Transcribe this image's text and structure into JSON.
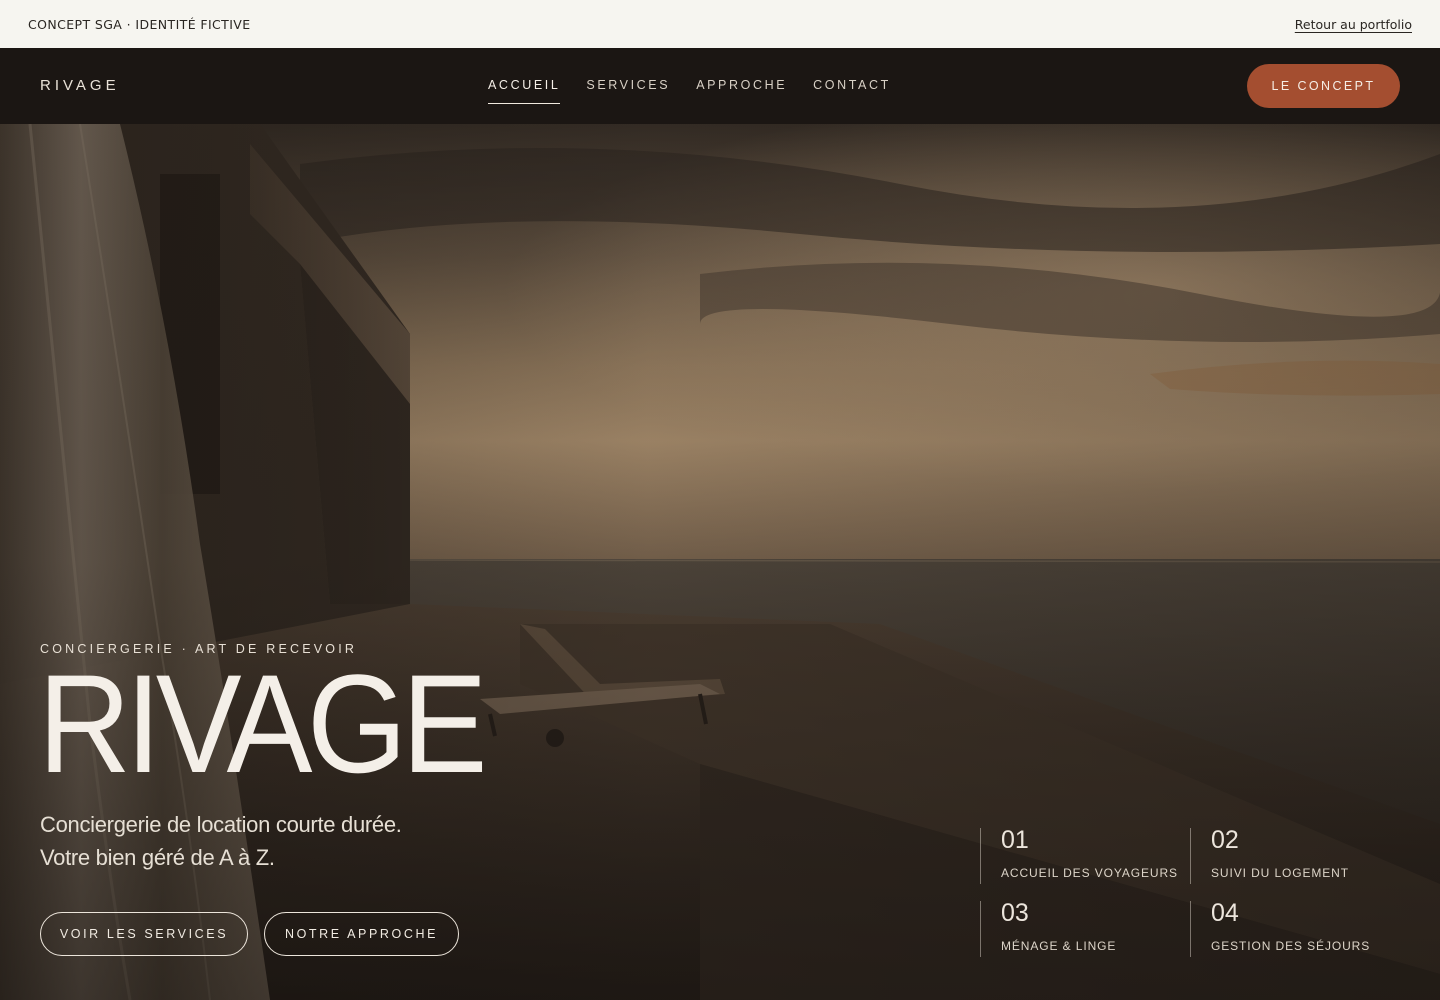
{
  "topbar": {
    "tag": "CONCEPT SGA · IDENTITÉ FICTIVE",
    "back_link": "Retour au portfolio"
  },
  "nav": {
    "brand": "RIVAGE",
    "items": [
      {
        "label": "ACCUEIL",
        "active": true
      },
      {
        "label": "SERVICES",
        "active": false
      },
      {
        "label": "APPROCHE",
        "active": false
      },
      {
        "label": "CONTACT",
        "active": false
      }
    ],
    "cta": "LE CONCEPT"
  },
  "hero": {
    "eyebrow": "CONCIERGERIE · ART DE RECEVOIR",
    "title": "RIVAGE",
    "subtitle_line1": "Conciergerie de location courte durée.",
    "subtitle_line2": "Votre bien géré de A à Z.",
    "buttons": {
      "primary": "VOIR LES SERVICES",
      "secondary": "NOTRE APPROCHE"
    },
    "stats": [
      {
        "num": "01",
        "label": "ACCUEIL DES VOYAGEURS"
      },
      {
        "num": "02",
        "label": "SUIVI DU LOGEMENT"
      },
      {
        "num": "03",
        "label": "MÉNAGE & LINGE"
      },
      {
        "num": "04",
        "label": "GESTION DES SÉJOURS"
      }
    ]
  },
  "colors": {
    "accent": "#a44e30",
    "nav_bg": "#1b1613",
    "topbar_bg": "#f6f5f0",
    "text_light": "#f4efe8"
  }
}
